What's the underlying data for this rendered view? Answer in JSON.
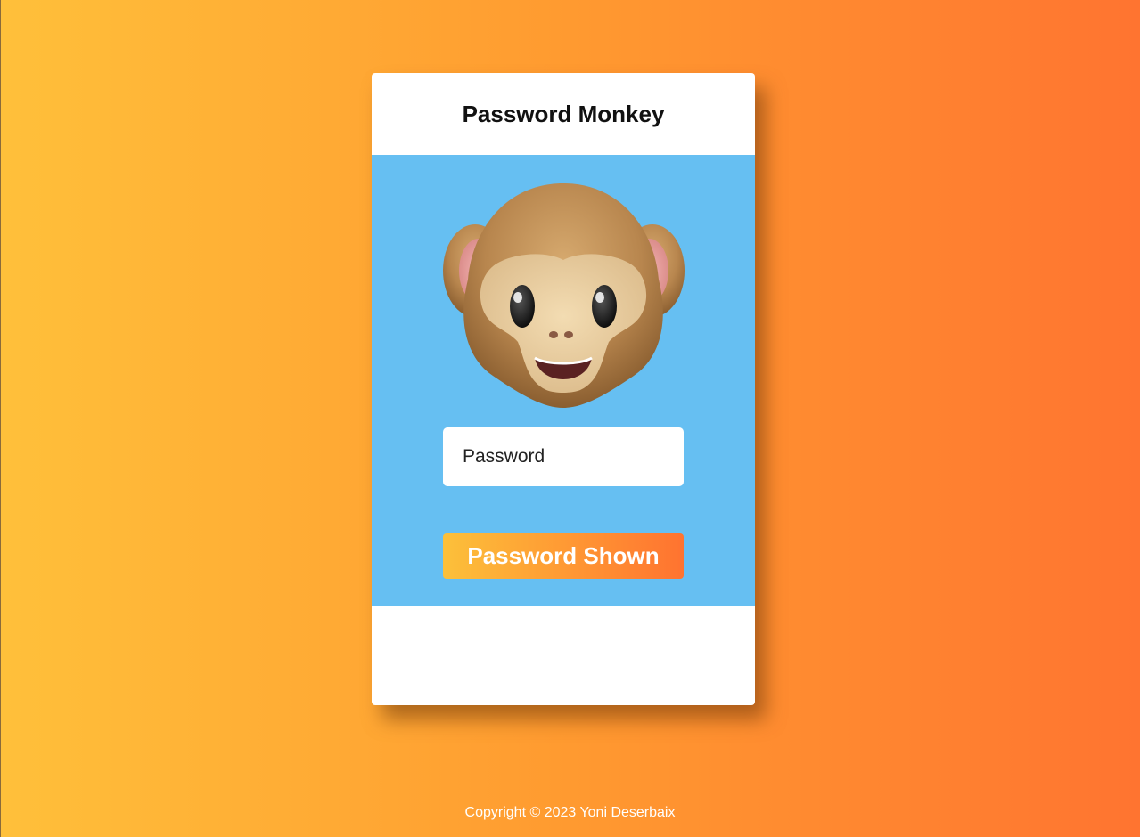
{
  "card": {
    "title": "Password Monkey"
  },
  "password": {
    "placeholder": "Password",
    "value": ""
  },
  "toggle_button": {
    "label": "Password Shown"
  },
  "footer": {
    "copyright": "Copyright © 2023 Yoni Deserbaix"
  },
  "icons": {
    "avatar": "monkey-face-icon"
  },
  "colors": {
    "background_start": "#ffc03a",
    "background_end": "#ff7430",
    "panel": "#66bff2",
    "card": "#ffffff"
  }
}
